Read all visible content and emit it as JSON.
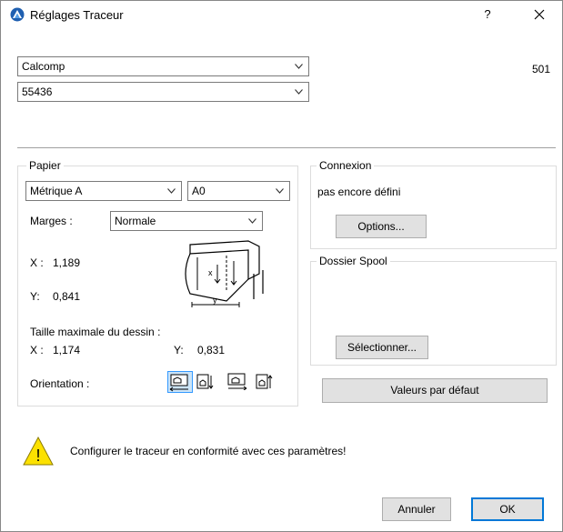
{
  "window": {
    "title": "Réglages Traceur",
    "help": "?",
    "close": "✕"
  },
  "plotter": {
    "manufacturer": "Calcomp",
    "model": "55436",
    "code": "501"
  },
  "paper": {
    "group_label": "Papier",
    "format_family": "Métrique A",
    "format_size": "A0",
    "margins_label": "Marges :",
    "margins_value": "Normale",
    "x_label": "X :",
    "x_value": "1,189",
    "y_label": "Y:",
    "y_value": "0,841",
    "max_size_label": "Taille maximale du dessin :",
    "max_x_label": "X :",
    "max_x_value": "1,174",
    "max_y_label": "Y:",
    "max_y_value": "0,831",
    "orientation_label": "Orientation :",
    "diagram_x": "x",
    "diagram_y": "y"
  },
  "connection": {
    "group_label": "Connexion",
    "status": "pas encore défini",
    "options_button": "Options..."
  },
  "spool": {
    "group_label": "Dossier Spool",
    "select_button": "Sélectionner..."
  },
  "defaults_button": "Valeurs par défaut",
  "warning": {
    "text": "Configurer le traceur en conformité avec ces paramètres!",
    "symbol": "!"
  },
  "footer": {
    "cancel": "Annuler",
    "ok": "OK"
  },
  "colors": {
    "accent": "#0078d7",
    "warning": "#fce100",
    "selected_bg": "#cce4f7"
  },
  "icons": [
    "archicad-app-icon",
    "help-icon",
    "close-icon",
    "chevron-down-icon",
    "plotter-diagram-icon",
    "warning-icon",
    "orientation-portrait-icon",
    "orientation-landscape-icon"
  ]
}
